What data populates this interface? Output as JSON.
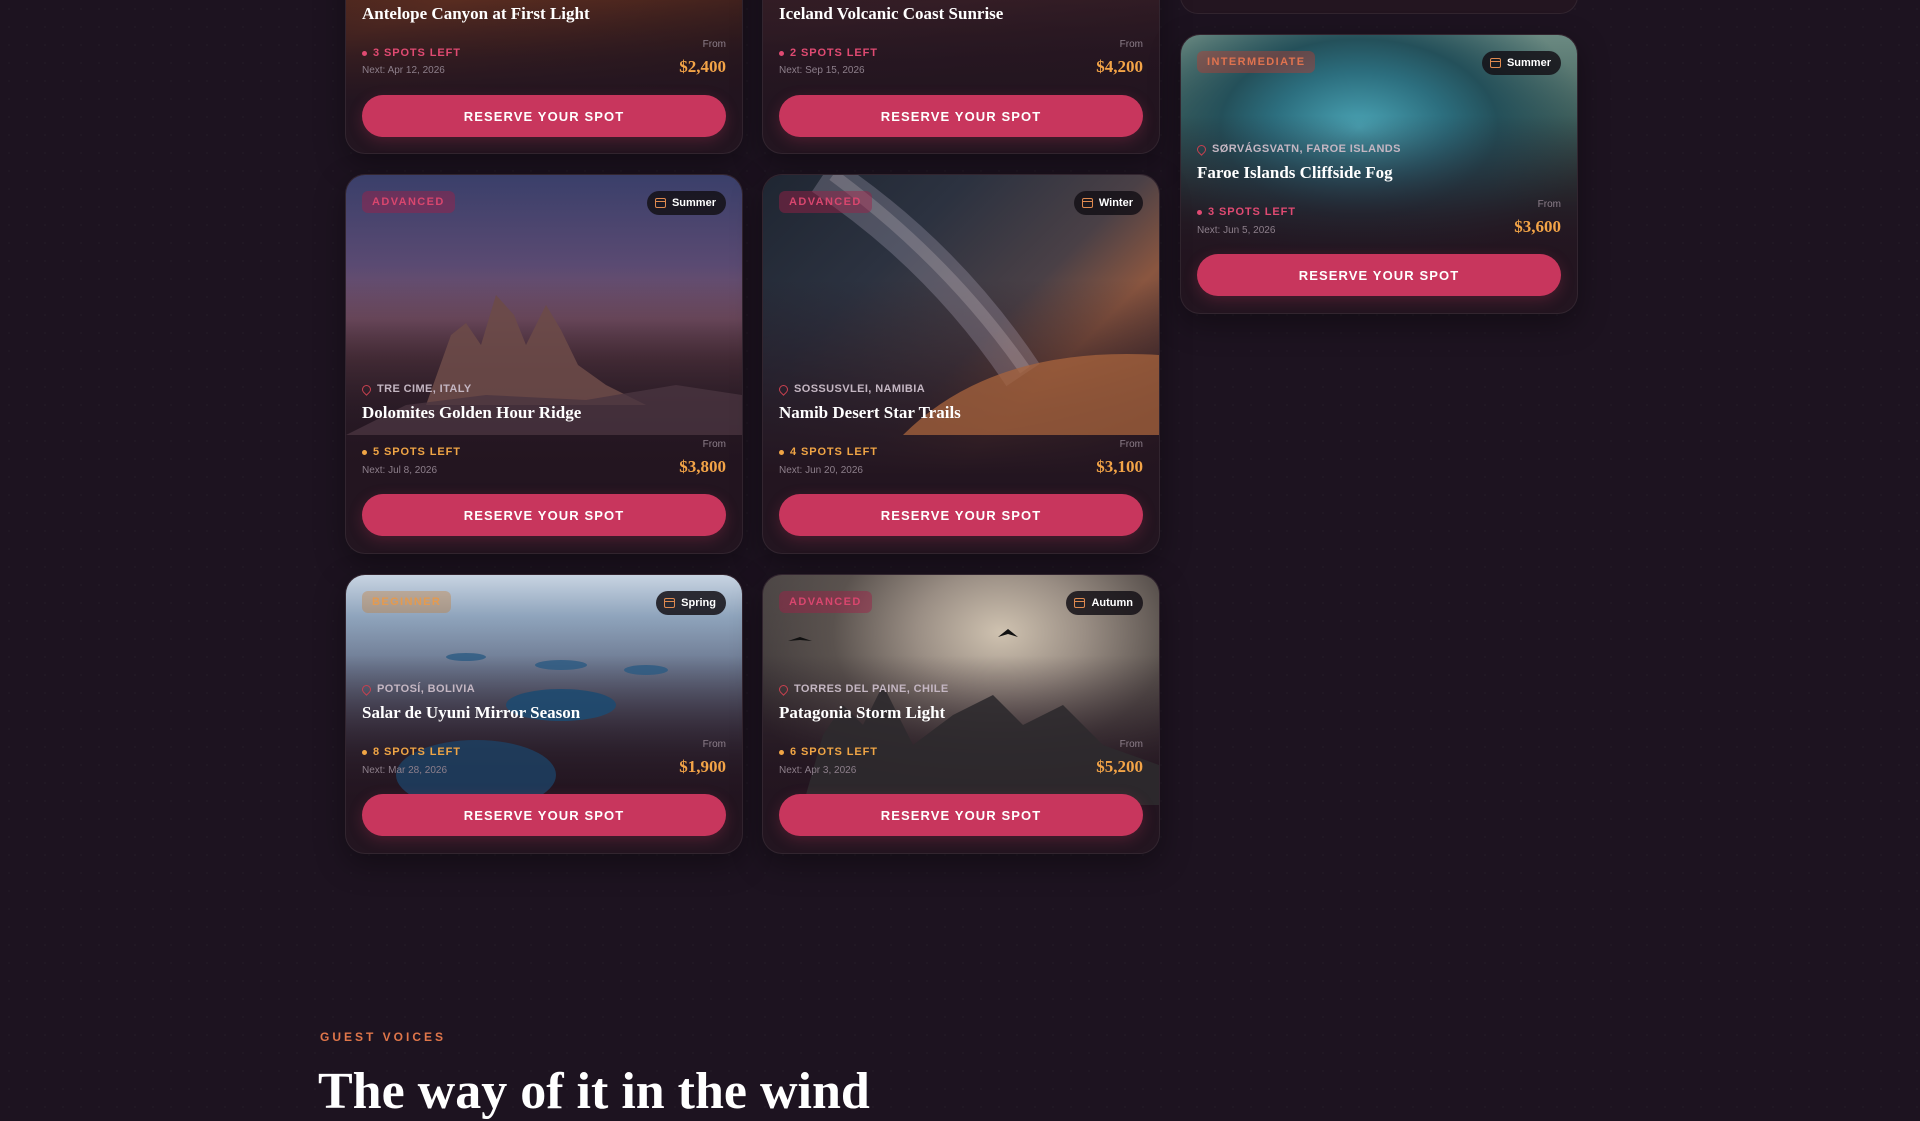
{
  "common": {
    "from_label": "From",
    "reserve_label": "RESERVE YOUR SPOT"
  },
  "cards": [
    {
      "title": "Antelope Canyon at First Light",
      "spots": "3 SPOTS LEFT",
      "next": "Next: Apr 12, 2026",
      "price": "$2,400"
    },
    {
      "title": "Iceland Volcanic Coast Sunrise",
      "spots": "2 SPOTS LEFT",
      "next": "Next: Sep 15, 2026",
      "price": "$4,200"
    },
    {
      "level": "INTERMEDIATE",
      "season": "Summer",
      "location": "SØRVÁGSVATN, FAROE ISLANDS",
      "title": "Faroe Islands Cliffside Fog",
      "spots": "3 SPOTS LEFT",
      "next": "Next: Jun 5, 2026",
      "price": "$3,600"
    },
    {
      "level": "ADVANCED",
      "season": "Summer",
      "location": "TRE CIME, ITALY",
      "title": "Dolomites Golden Hour Ridge",
      "spots": "5 SPOTS LEFT",
      "next": "Next: Jul 8, 2026",
      "price": "$3,800"
    },
    {
      "level": "ADVANCED",
      "season": "Winter",
      "location": "SOSSUSVLEI, NAMIBIA",
      "title": "Namib Desert Star Trails",
      "spots": "4 SPOTS LEFT",
      "next": "Next: Jun 20, 2026",
      "price": "$3,100"
    },
    {
      "level": "BEGINNER",
      "season": "Spring",
      "location": "POTOSÍ, BOLIVIA",
      "title": "Salar de Uyuni Mirror Season",
      "spots": "8 SPOTS LEFT",
      "next": "Next: Mar 28, 2026",
      "price": "$1,900"
    },
    {
      "level": "ADVANCED",
      "season": "Autumn",
      "location": "TORRES DEL PAINE, CHILE",
      "title": "Patagonia Storm Light",
      "spots": "6 SPOTS LEFT",
      "next": "Next: Apr 3, 2026",
      "price": "$5,200"
    }
  ],
  "testimonials": {
    "eyebrow": "GUEST VOICES",
    "heading": "The way of it in the wind"
  }
}
